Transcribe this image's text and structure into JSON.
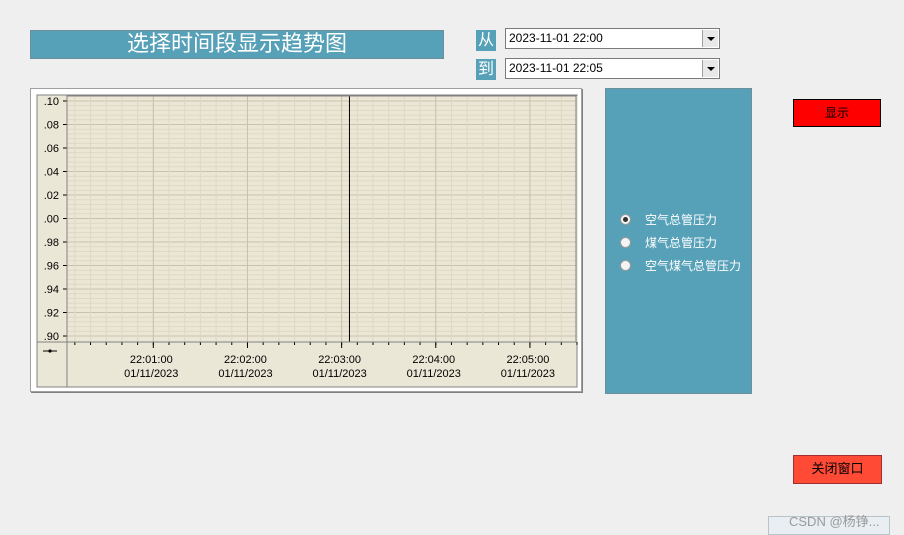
{
  "title": "选择时间段显示趋势图",
  "from": {
    "label": "从",
    "value": "2023-11-01 22:00"
  },
  "to": {
    "label": "到",
    "value": "2023-11-01 22:05"
  },
  "chart_data": {
    "type": "line",
    "y_tick_labels": [
      ".10",
      ".08",
      ".06",
      ".04",
      ".02",
      ".00",
      ".98",
      ".96",
      ".94",
      ".92",
      ".90"
    ],
    "x_ticks": [
      {
        "time": "22:01:00",
        "date": "01/11/2023"
      },
      {
        "time": "22:02:00",
        "date": "01/11/2023"
      },
      {
        "time": "22:03:00",
        "date": "01/11/2023"
      },
      {
        "time": "22:04:00",
        "date": "01/11/2023"
      },
      {
        "time": "22:05:00",
        "date": "01/11/2023"
      }
    ],
    "xlim": [
      "22:00:05",
      "22:05:30"
    ],
    "cursor_x": "22:03:05",
    "grid": true,
    "series": []
  },
  "radio_options": [
    {
      "label": "空气总管压力",
      "selected": true
    },
    {
      "label": "煤气总管压力",
      "selected": false
    },
    {
      "label": "空气煤气总管压力",
      "selected": false
    }
  ],
  "buttons": {
    "show": "显示",
    "close": "关闭窗口"
  },
  "watermark": "CSDN @杨铮...",
  "colors": {
    "panel": "#56a0b8",
    "plot_bg": "#ebe7d6",
    "show_button": "#ff0000",
    "close_button": "#ff4a36"
  }
}
